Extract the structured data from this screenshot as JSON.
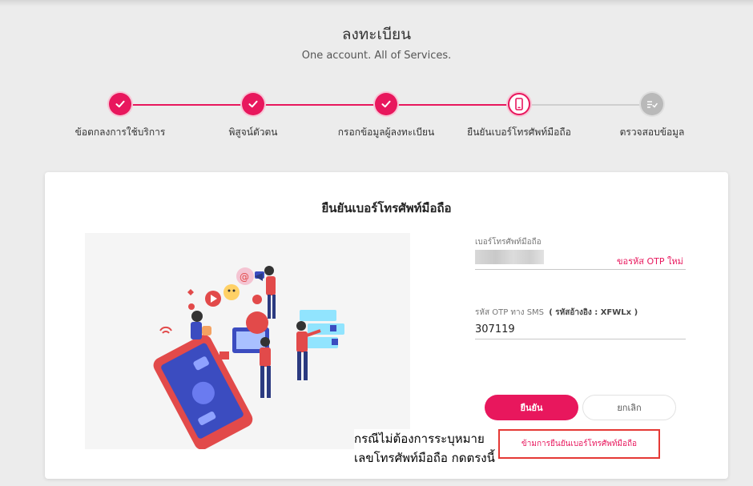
{
  "header": {
    "title": "ลงทะเบียน",
    "subtitle": "One account. All of Services."
  },
  "steps": [
    {
      "label": "ข้อตกลงการใช้บริการ",
      "status": "done",
      "icon": "check-icon"
    },
    {
      "label": "พิสูจน์ตัวตน",
      "status": "done",
      "icon": "check-icon"
    },
    {
      "label": "กรอกข้อมูลผู้ลงทะเบียน",
      "status": "done",
      "icon": "check-icon"
    },
    {
      "label": "ยืนยันเบอร์โทรศัพท์มือถือ",
      "status": "active",
      "icon": "mobile-phone-icon"
    },
    {
      "label": "ตรวจสอบข้อมูล",
      "status": "todo",
      "icon": "checklist-icon"
    }
  ],
  "card": {
    "title": "ยืนยันเบอร์โทรศัพท์มือถือ",
    "phone_label": "เบอร์โทรศัพท์มือถือ",
    "request_otp_link": "ขอรหัส OTP ใหม่",
    "otp_label": "รหัส OTP ทาง SMS",
    "otp_ref": "( รหัสอ้างอิง : XFWLx )",
    "otp_value": "307119",
    "confirm_button": "ยืนยัน",
    "cancel_button": "ยกเลิก",
    "skip_link": "ข้ามการยืนยันเบอร์โทรศัพท์มือถือ"
  },
  "annotation": {
    "line1": "กรณีไม่ต้องการระบุหมาย",
    "line2": "เลขโทรศัพท์มือถือ กดตรงนี้"
  },
  "colors": {
    "accent": "#e8175d",
    "inactive": "#b9b9b9",
    "highlight_box": "#e53935",
    "background": "#ececec"
  }
}
